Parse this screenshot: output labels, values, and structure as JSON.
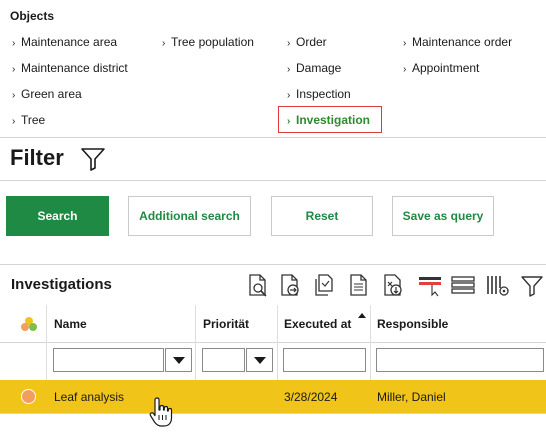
{
  "objects": {
    "title": "Objects",
    "col1": [
      "Maintenance area",
      "Maintenance district",
      "Green area",
      "Tree"
    ],
    "col2": [
      "Tree population"
    ],
    "col3": [
      "Order",
      "Damage",
      "Inspection",
      "Investigation"
    ],
    "col4": [
      "Maintenance order",
      "Appointment"
    ],
    "active": "Investigation",
    "active_color": "#2f8a2f",
    "highlight_color": "#e03a3a"
  },
  "filter": {
    "title": "Filter",
    "icon": "funnel-icon"
  },
  "buttons": {
    "search": "Search",
    "additional_search": "Additional search",
    "reset": "Reset",
    "save_as_query": "Save as query",
    "primary_color": "#1e8a44"
  },
  "investigations": {
    "title": "Investigations",
    "toolbar_icons": [
      "document-search-icon",
      "document-export-icon",
      "copy-document-icon",
      "document-icon",
      "document-import-icon",
      "selection-icon",
      "list-rows-icon",
      "column-settings-icon",
      "filter-icon"
    ],
    "columns": {
      "name": "Name",
      "priority": "Priorität",
      "executed_at": "Executed at",
      "responsible": "Responsible"
    },
    "sort_column": "Executed at",
    "rows": [
      {
        "name": "Leaf analysis",
        "priority": "",
        "executed_at": "3/28/2024",
        "responsible": "Miller, Daniel",
        "status_color": "#f29e5c"
      }
    ],
    "selected_row_color": "#f0c419"
  }
}
